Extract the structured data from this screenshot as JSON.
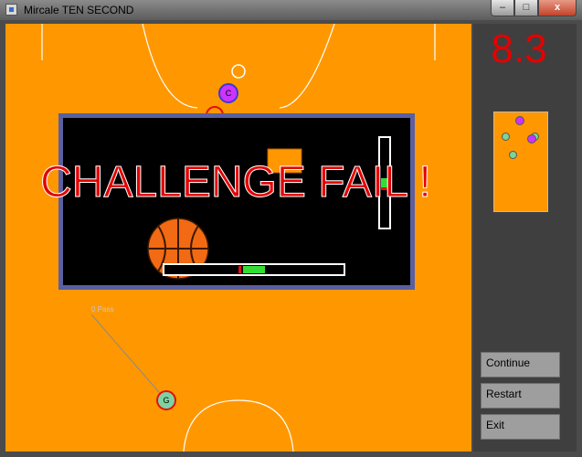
{
  "window": {
    "title": "Mircale TEN SECOND"
  },
  "window_buttons": {
    "minimize": "–",
    "maximize": "□",
    "close": "x"
  },
  "timer": "8.3",
  "overlay": {
    "message": "CHALLENGE FAIL !"
  },
  "court": {
    "label": "0 Pass",
    "players": [
      {
        "id": "c",
        "label": "C",
        "color": "#cc33ff"
      },
      {
        "id": "g",
        "label": "G",
        "color": "#7dd3a0"
      }
    ]
  },
  "menu": {
    "continue": "Continue",
    "restart": "Restart",
    "exit": "Exit"
  },
  "colors": {
    "court": "#ff9800",
    "accent": "#e60000",
    "overlay_border": "#5a5fa0"
  }
}
